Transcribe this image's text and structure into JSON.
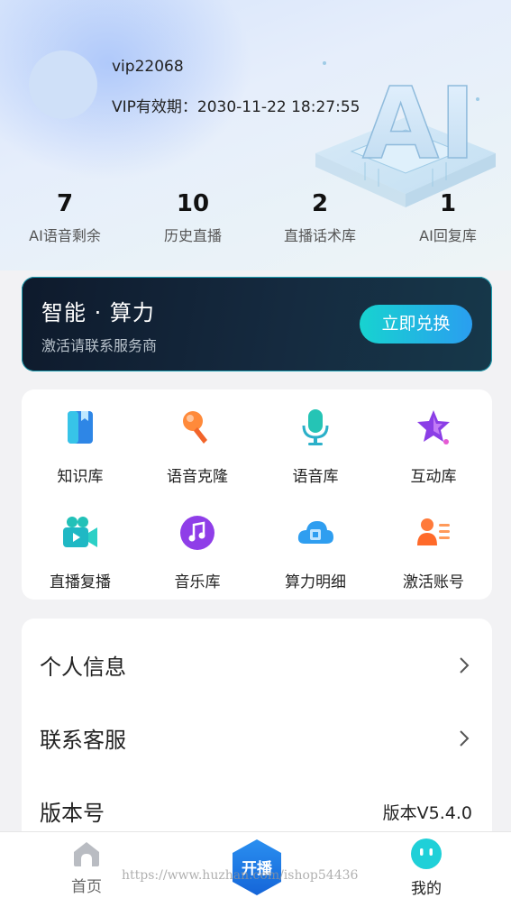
{
  "profile": {
    "username": "vip22068",
    "vip_label": "VIP有效期：",
    "vip_expiry": "2030-11-22 18:27:55",
    "art_text": "AI"
  },
  "stats": [
    {
      "value": "7",
      "label": "AI语音剩余"
    },
    {
      "value": "10",
      "label": "历史直播"
    },
    {
      "value": "2",
      "label": "直播话术库"
    },
    {
      "value": "1",
      "label": "AI回复库"
    }
  ],
  "banner": {
    "title": "智能 · 算力",
    "subtitle": "激活请联系服务商",
    "button_label": "立即兑换"
  },
  "features": [
    {
      "label": "知识库",
      "icon": "book-icon"
    },
    {
      "label": "语音克隆",
      "icon": "microphone-orange-icon"
    },
    {
      "label": "语音库",
      "icon": "microphone-teal-icon"
    },
    {
      "label": "互动库",
      "icon": "star-icon"
    },
    {
      "label": "直播复播",
      "icon": "video-camera-icon"
    },
    {
      "label": "音乐库",
      "icon": "music-note-icon"
    },
    {
      "label": "算力明细",
      "icon": "cloud-chip-icon"
    },
    {
      "label": "激活账号",
      "icon": "user-card-icon"
    }
  ],
  "menu": {
    "personal_info": "个人信息",
    "contact_service": "联系客服",
    "version_label": "版本号",
    "version_value": "版本V5.4.0"
  },
  "tabbar": {
    "home": "首页",
    "live": "开播",
    "mine": "我的"
  },
  "watermark": "https://www.huzhan.com/ishop54436",
  "colors": {
    "accent_teal": "#17d3d0",
    "accent_blue": "#2a9ef0",
    "banner_bg": "#0e1a2c"
  }
}
